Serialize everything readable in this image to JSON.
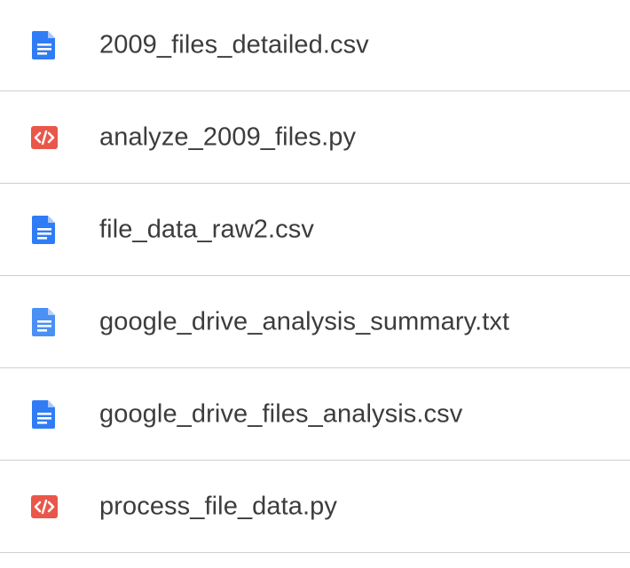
{
  "files": [
    {
      "name": "2009_files_detailed.csv",
      "icon": "document-icon",
      "icon_color": "#2f7cf6"
    },
    {
      "name": "analyze_2009_files.py",
      "icon": "code-file-icon",
      "icon_color": "#e9574a"
    },
    {
      "name": "file_data_raw2.csv",
      "icon": "document-icon",
      "icon_color": "#2f7cf6"
    },
    {
      "name": "google_drive_analysis_summary.txt",
      "icon": "document-icon",
      "icon_color": "#4a90f5"
    },
    {
      "name": "google_drive_files_analysis.csv",
      "icon": "document-icon",
      "icon_color": "#2f7cf6"
    },
    {
      "name": "process_file_data.py",
      "icon": "code-file-icon",
      "icon_color": "#e9574a"
    }
  ]
}
